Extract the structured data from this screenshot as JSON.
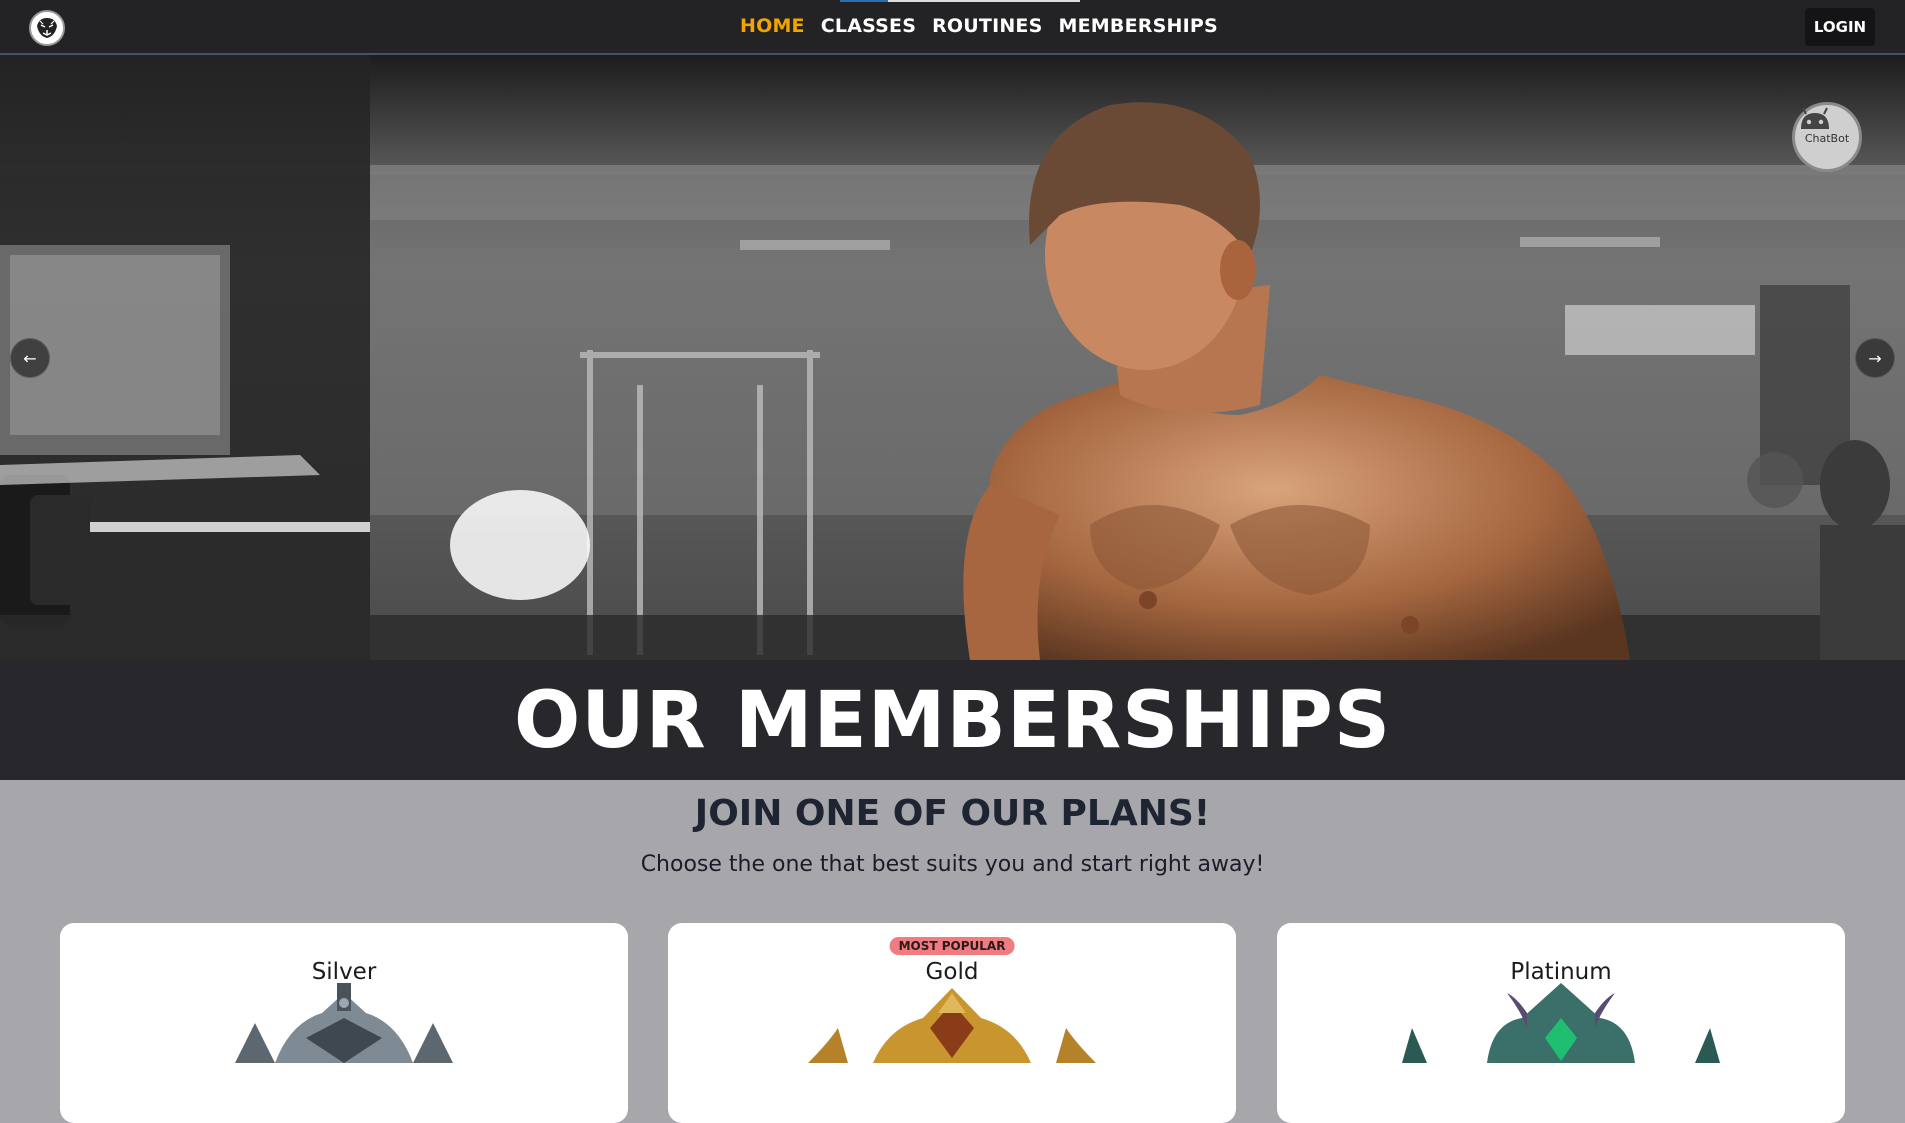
{
  "navbar": {
    "links": [
      "HOME",
      "CLASSES",
      "ROUTINES",
      "MEMBERSHIPS"
    ],
    "active": "HOME",
    "login_label": "LOGIN",
    "logo_icon": "tiger-logo-icon"
  },
  "hero": {
    "prev_icon": "arrow-left-icon",
    "next_icon": "arrow-right-icon",
    "prev_glyph": "←",
    "next_glyph": "→",
    "chatbot_label": "ChatBot",
    "chatbot_icon": "android-robot-icon"
  },
  "memberships": {
    "title": "OUR MEMBERSHIPS",
    "heading": "JOIN ONE OF OUR PLANS!",
    "subheading": "Choose the one that best suits you and start right away!",
    "plans": [
      {
        "name": "Silver",
        "badge": "",
        "emblem": "silver-crest-icon",
        "color": "#6f7b86"
      },
      {
        "name": "Gold",
        "badge": "MOST POPULAR",
        "emblem": "gold-crest-icon",
        "color": "#c7902a"
      },
      {
        "name": "Platinum",
        "badge": "",
        "emblem": "platinum-crest-icon",
        "color": "#2f6f6a"
      }
    ]
  },
  "colors": {
    "nav_bg": "#232225",
    "nav_active": "#f0a500",
    "band_bg": "#28272c",
    "page_bg": "#a7a6ab",
    "badge_bg": "#f07b80"
  }
}
